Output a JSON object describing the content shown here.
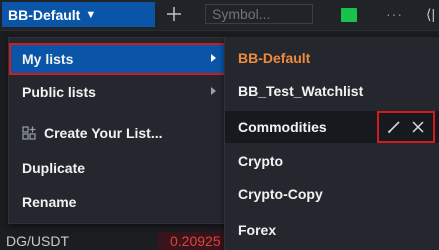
{
  "toolbar": {
    "watchlist_name": "BB-Default",
    "caret": "▼",
    "add_icon": "plus-icon",
    "symbol_placeholder": "Symbol...",
    "status_color": "#19c24a",
    "more_label": "···",
    "edge_label": "⟨|"
  },
  "menu": {
    "items": [
      {
        "label": "My lists",
        "has_submenu": true,
        "active": true
      },
      {
        "label": "Public lists",
        "has_submenu": true
      },
      {
        "label": "Create Your List...",
        "icon": "create-list-icon"
      },
      {
        "label": "Duplicate"
      },
      {
        "label": "Rename"
      }
    ]
  },
  "submenu": {
    "items": [
      {
        "label": "BB-Default",
        "current": true
      },
      {
        "label": "BB_Test_Watchlist"
      },
      {
        "label": "Commodities",
        "hovered": true
      },
      {
        "label": "Crypto"
      },
      {
        "label": "Crypto-Copy"
      },
      {
        "label": "Forex"
      }
    ],
    "hover_actions": [
      "pencil-icon",
      "close-icon"
    ]
  },
  "background_row": {
    "pair": "DG/USDT",
    "price": "0.20925"
  },
  "colors": {
    "accent_blue": "#0a55a7",
    "highlight_red": "#d01c1c",
    "current_list_orange": "#f08a3c",
    "negative_red": "#e0433f"
  }
}
